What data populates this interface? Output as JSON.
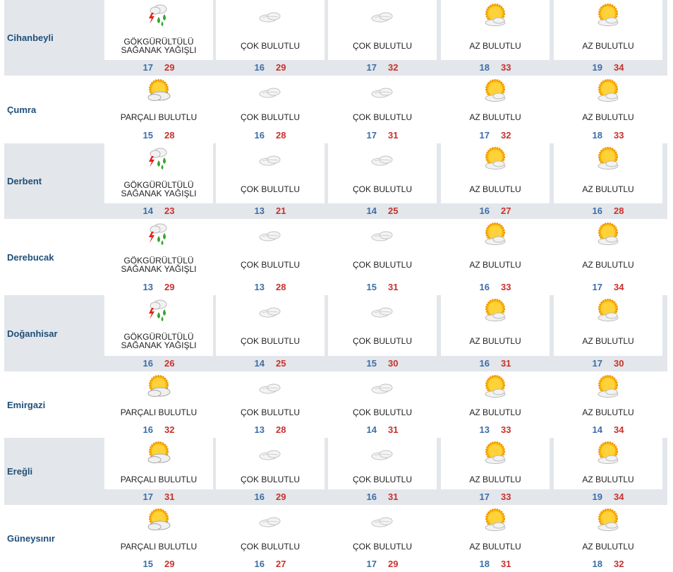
{
  "colors": {
    "city": "#1f4f79",
    "min": "#3c6ea8",
    "max": "#c8312e",
    "alt_bg": "#e3e6ea"
  },
  "rows": [
    {
      "city": "Cihanbeyli",
      "days": [
        {
          "icon": "thunderstorm-icon",
          "desc": "GÖKGÜRÜLTÜLÜ SAĞANAK YAĞIŞLI",
          "min": "17",
          "max": "29"
        },
        {
          "icon": "cloudy-icon",
          "desc": "ÇOK BULUTLU",
          "min": "16",
          "max": "29"
        },
        {
          "icon": "cloudy-icon",
          "desc": "ÇOK BULUTLU",
          "min": "17",
          "max": "32"
        },
        {
          "icon": "sun-cloud-icon",
          "desc": "AZ BULUTLU",
          "min": "18",
          "max": "33"
        },
        {
          "icon": "sun-cloud-icon",
          "desc": "AZ BULUTLU",
          "min": "19",
          "max": "34"
        }
      ]
    },
    {
      "city": "Çumra",
      "days": [
        {
          "icon": "partly-cloudy-icon",
          "desc": "PARÇALI BULUTLU",
          "min": "15",
          "max": "28"
        },
        {
          "icon": "cloudy-icon",
          "desc": "ÇOK BULUTLU",
          "min": "16",
          "max": "28"
        },
        {
          "icon": "cloudy-icon",
          "desc": "ÇOK BULUTLU",
          "min": "17",
          "max": "31"
        },
        {
          "icon": "sun-cloud-icon",
          "desc": "AZ BULUTLU",
          "min": "17",
          "max": "32"
        },
        {
          "icon": "sun-cloud-icon",
          "desc": "AZ BULUTLU",
          "min": "18",
          "max": "33"
        }
      ]
    },
    {
      "city": "Derbent",
      "days": [
        {
          "icon": "thunderstorm-icon",
          "desc": "GÖKGÜRÜLTÜLÜ SAĞANAK YAĞIŞLI",
          "min": "14",
          "max": "23"
        },
        {
          "icon": "cloudy-icon",
          "desc": "ÇOK BULUTLU",
          "min": "13",
          "max": "21"
        },
        {
          "icon": "cloudy-icon",
          "desc": "ÇOK BULUTLU",
          "min": "14",
          "max": "25"
        },
        {
          "icon": "sun-cloud-icon",
          "desc": "AZ BULUTLU",
          "min": "16",
          "max": "27"
        },
        {
          "icon": "sun-cloud-icon",
          "desc": "AZ BULUTLU",
          "min": "16",
          "max": "28"
        }
      ]
    },
    {
      "city": "Derebucak",
      "days": [
        {
          "icon": "thunderstorm-icon",
          "desc": "GÖKGÜRÜLTÜLÜ SAĞANAK YAĞIŞLI",
          "min": "13",
          "max": "29"
        },
        {
          "icon": "cloudy-icon",
          "desc": "ÇOK BULUTLU",
          "min": "13",
          "max": "28"
        },
        {
          "icon": "cloudy-icon",
          "desc": "ÇOK BULUTLU",
          "min": "15",
          "max": "31"
        },
        {
          "icon": "sun-cloud-icon",
          "desc": "AZ BULUTLU",
          "min": "16",
          "max": "33"
        },
        {
          "icon": "sun-cloud-icon",
          "desc": "AZ BULUTLU",
          "min": "17",
          "max": "34"
        }
      ]
    },
    {
      "city": "Doğanhisar",
      "days": [
        {
          "icon": "thunderstorm-icon",
          "desc": "GÖKGÜRÜLTÜLÜ SAĞANAK YAĞIŞLI",
          "min": "16",
          "max": "26"
        },
        {
          "icon": "cloudy-icon",
          "desc": "ÇOK BULUTLU",
          "min": "14",
          "max": "25"
        },
        {
          "icon": "cloudy-icon",
          "desc": "ÇOK BULUTLU",
          "min": "15",
          "max": "30"
        },
        {
          "icon": "sun-cloud-icon",
          "desc": "AZ BULUTLU",
          "min": "16",
          "max": "31"
        },
        {
          "icon": "sun-cloud-icon",
          "desc": "AZ BULUTLU",
          "min": "17",
          "max": "30"
        }
      ]
    },
    {
      "city": "Emirgazi",
      "days": [
        {
          "icon": "partly-cloudy-icon",
          "desc": "PARÇALI BULUTLU",
          "min": "16",
          "max": "32"
        },
        {
          "icon": "cloudy-icon",
          "desc": "ÇOK BULUTLU",
          "min": "13",
          "max": "28"
        },
        {
          "icon": "cloudy-icon",
          "desc": "ÇOK BULUTLU",
          "min": "14",
          "max": "31"
        },
        {
          "icon": "sun-cloud-icon",
          "desc": "AZ BULUTLU",
          "min": "13",
          "max": "33"
        },
        {
          "icon": "sun-cloud-icon",
          "desc": "AZ BULUTLU",
          "min": "14",
          "max": "34"
        }
      ]
    },
    {
      "city": "Ereğli",
      "days": [
        {
          "icon": "partly-cloudy-icon",
          "desc": "PARÇALI BULUTLU",
          "min": "17",
          "max": "31"
        },
        {
          "icon": "cloudy-icon",
          "desc": "ÇOK BULUTLU",
          "min": "16",
          "max": "29"
        },
        {
          "icon": "cloudy-icon",
          "desc": "ÇOK BULUTLU",
          "min": "16",
          "max": "31"
        },
        {
          "icon": "sun-cloud-icon",
          "desc": "AZ BULUTLU",
          "min": "17",
          "max": "33"
        },
        {
          "icon": "sun-cloud-icon",
          "desc": "AZ BULUTLU",
          "min": "19",
          "max": "34"
        }
      ]
    },
    {
      "city": "Güneysınır",
      "days": [
        {
          "icon": "partly-cloudy-icon",
          "desc": "PARÇALI BULUTLU",
          "min": "15",
          "max": "29"
        },
        {
          "icon": "cloudy-icon",
          "desc": "ÇOK BULUTLU",
          "min": "16",
          "max": "27"
        },
        {
          "icon": "cloudy-icon",
          "desc": "ÇOK BULUTLU",
          "min": "17",
          "max": "29"
        },
        {
          "icon": "sun-cloud-icon",
          "desc": "AZ BULUTLU",
          "min": "18",
          "max": "31"
        },
        {
          "icon": "sun-cloud-icon",
          "desc": "AZ BULUTLU",
          "min": "18",
          "max": "32"
        }
      ]
    }
  ]
}
